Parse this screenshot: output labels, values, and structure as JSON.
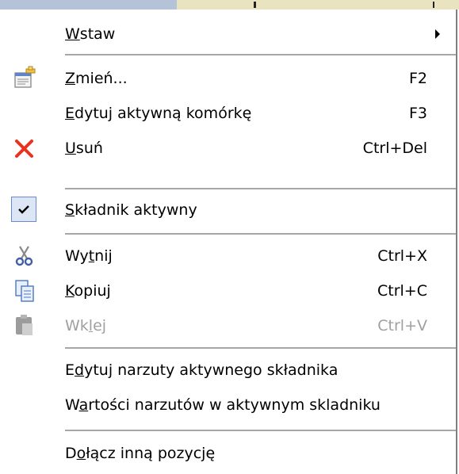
{
  "menu": {
    "items": [
      {
        "id": "wstaw",
        "pre": "",
        "u": "W",
        "post": "staw",
        "shortcut": "",
        "submenu": true
      },
      {
        "id": "zmien",
        "pre": "",
        "u": "Z",
        "post": "mień...",
        "shortcut": "F2",
        "icon": "edit-properties-icon"
      },
      {
        "id": "edytuj-komorke",
        "pre": "",
        "u": "E",
        "post": "dytuj aktywną komórkę",
        "shortcut": "F3"
      },
      {
        "id": "usun",
        "pre": "",
        "u": "U",
        "post": "suń",
        "shortcut": "Ctrl+Del",
        "icon": "delete-icon"
      },
      {
        "id": "skladnik-aktywny",
        "pre": "",
        "u": "S",
        "post": "kładnik aktywny",
        "shortcut": "",
        "checked": true
      },
      {
        "id": "wytnij",
        "pre": "Wy",
        "u": "t",
        "post": "nij",
        "shortcut": "Ctrl+X",
        "icon": "scissors-icon"
      },
      {
        "id": "kopiuj",
        "pre": "",
        "u": "K",
        "post": "opiuj",
        "shortcut": "Ctrl+C",
        "icon": "copy-icon"
      },
      {
        "id": "wklej",
        "pre": "Wk",
        "u": "l",
        "post": "ej",
        "shortcut": "Ctrl+V",
        "icon": "paste-icon",
        "disabled": true
      },
      {
        "id": "edytuj-narzuty",
        "pre": "E",
        "u": "d",
        "post": "ytuj narzuty aktywnego składnika",
        "shortcut": ""
      },
      {
        "id": "wartosci-narzutow",
        "pre": "W",
        "u": "a",
        "post": "rtości narzutów w aktywnym skladniku",
        "shortcut": ""
      },
      {
        "id": "dolacz",
        "pre": "D",
        "u": "o",
        "post": "łącz inną pozycję",
        "shortcut": ""
      }
    ]
  },
  "colors": {
    "delete_red": "#e8321e",
    "scissors_blue": "#3f5fa8",
    "disabled_text": "#a0a0a0",
    "separator": "#a7a7a7"
  }
}
